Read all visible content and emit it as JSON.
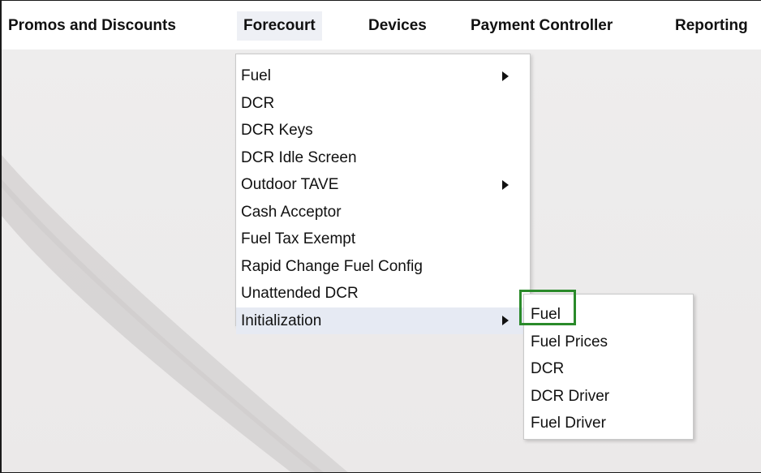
{
  "menubar": {
    "items": [
      {
        "label": "Promos and Discounts",
        "active": false
      },
      {
        "label": "Forecourt",
        "active": true
      },
      {
        "label": "Devices",
        "active": false
      },
      {
        "label": "Payment Controller",
        "active": false
      },
      {
        "label": "Reporting",
        "active": false
      }
    ]
  },
  "forecourt_menu": {
    "items": [
      {
        "label": "Fuel",
        "has_submenu": true
      },
      {
        "label": "DCR",
        "has_submenu": false
      },
      {
        "label": "DCR Keys",
        "has_submenu": false
      },
      {
        "label": "DCR Idle Screen",
        "has_submenu": false
      },
      {
        "label": "Outdoor TAVE",
        "has_submenu": true
      },
      {
        "label": "Cash Acceptor",
        "has_submenu": false
      },
      {
        "label": "Fuel Tax Exempt",
        "has_submenu": false
      },
      {
        "label": "Rapid Change Fuel Config",
        "has_submenu": false
      },
      {
        "label": "Unattended DCR",
        "has_submenu": false
      },
      {
        "label": "Initialization",
        "has_submenu": true,
        "hovered": true
      }
    ]
  },
  "initialization_submenu": {
    "items": [
      {
        "label": "Fuel",
        "highlighted": true
      },
      {
        "label": "Fuel Prices"
      },
      {
        "label": "DCR"
      },
      {
        "label": "DCR Driver"
      },
      {
        "label": "Fuel Driver"
      }
    ]
  },
  "colors": {
    "highlight_box": "#2a8a2a",
    "hover_row": "#e6eaf3",
    "background": "#ebe8e8"
  }
}
